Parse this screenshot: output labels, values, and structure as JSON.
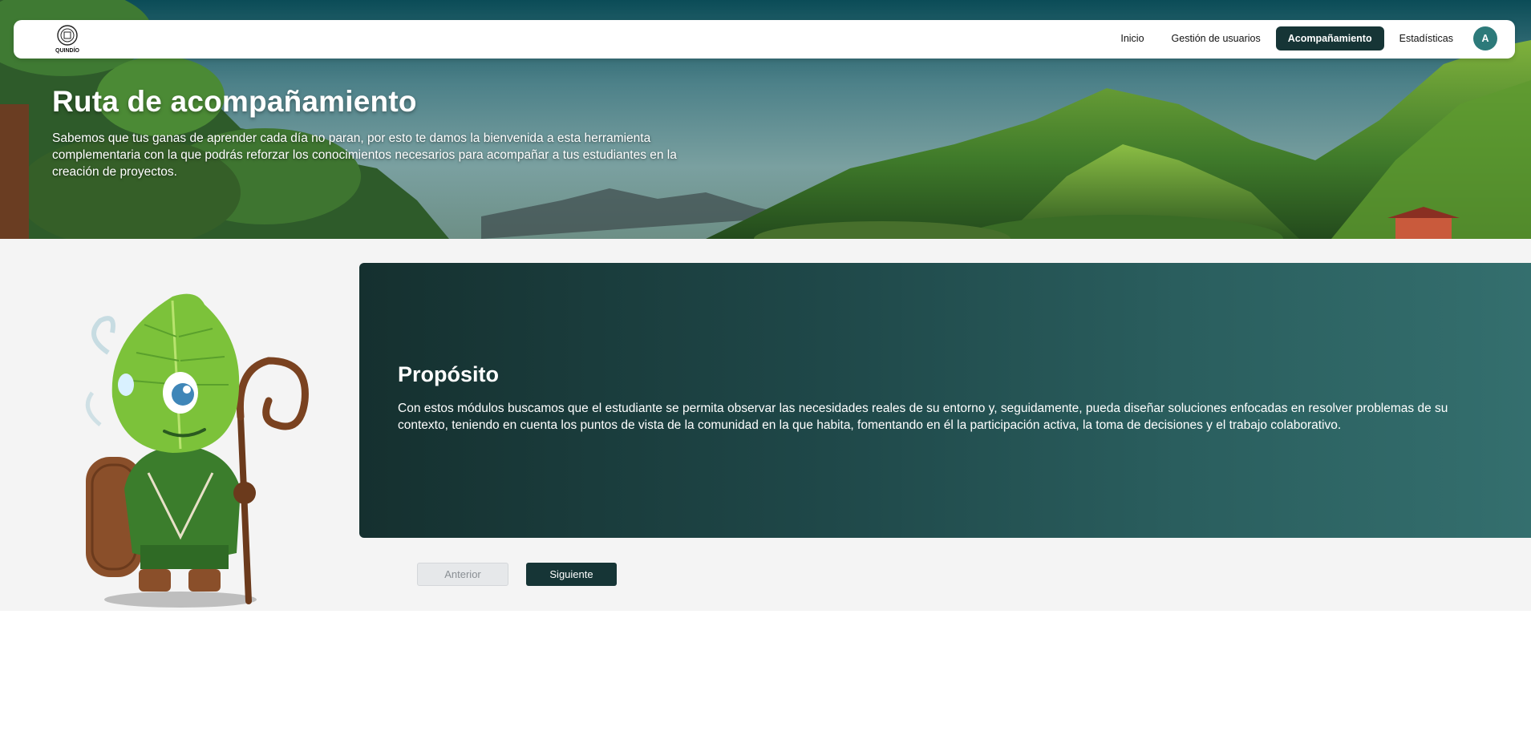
{
  "logo": {
    "text": "QUINDÍO"
  },
  "nav": {
    "items": [
      {
        "label": "Inicio",
        "active": false
      },
      {
        "label": "Gestión de usuarios",
        "active": false
      },
      {
        "label": "Acompañamiento",
        "active": true
      },
      {
        "label": "Estadísticas",
        "active": false
      }
    ],
    "avatar_initial": "A"
  },
  "hero": {
    "title": "Ruta de acompañamiento",
    "description": "Sabemos que tus ganas de aprender cada día no paran, por esto te damos la bienvenida a esta herramienta complementaria con la que podrás reforzar los conocimientos necesarios para acompañar a tus estudiantes en la creación de proyectos."
  },
  "purpose": {
    "title": "Propósito",
    "text": "Con estos módulos buscamos que el estudiante se permita observar las necesidades reales de su entorno y, seguidamente, pueda diseñar soluciones enfocadas en resolver problemas de su contexto, teniendo en cuenta los puntos de vista de la comunidad en la que habita, fomentando en él la participación activa, la toma de decisiones y el trabajo colaborativo."
  },
  "buttons": {
    "prev_label": "Anterior",
    "next_label": "Siguiente"
  },
  "colors": {
    "primary": "#163536",
    "accent": "#2d7a7a",
    "card_start": "#15302f",
    "card_end": "#346f6e"
  }
}
